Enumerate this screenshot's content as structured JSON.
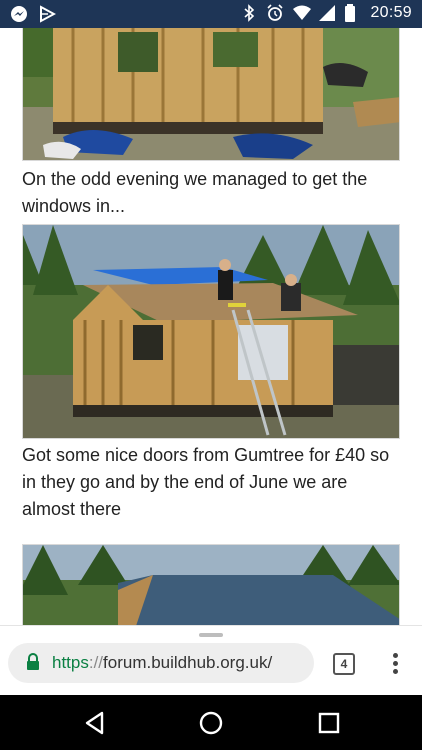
{
  "status_bar": {
    "time": "20:59",
    "left_icons": [
      "messenger-icon",
      "play-icon"
    ],
    "right_icons": [
      "bluetooth-icon",
      "alarm-icon",
      "wifi-icon",
      "signal-icon",
      "battery-icon"
    ]
  },
  "article": {
    "captions": [
      "On the odd evening we managed to get the windows in...",
      "Got some nice doors from Gumtree for £40 so in they go and by the end of June we are almost there"
    ],
    "photos": [
      "cabin-frame-photo",
      "cabin-roof-photo",
      "cabin-complete-photo"
    ]
  },
  "browser": {
    "url_scheme": "https",
    "url_separator": "://",
    "url_host": "forum.buildhub.org.uk/",
    "tab_count": "4"
  },
  "colors": {
    "status_bar": "#1e3556",
    "url_scheme": "#0b8043",
    "nav_bar": "#000000"
  }
}
